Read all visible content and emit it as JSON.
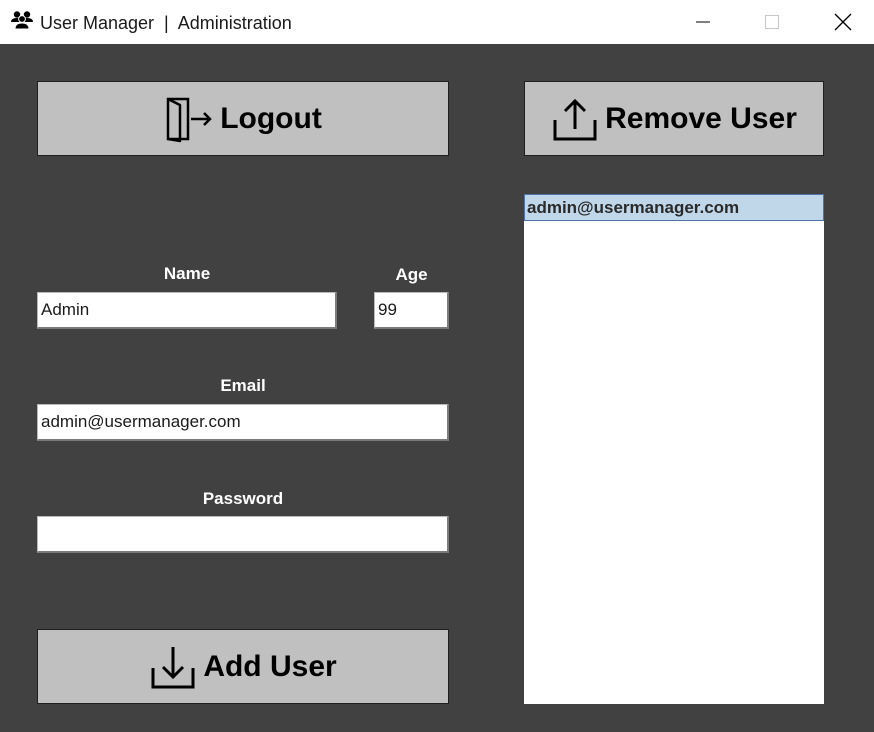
{
  "window": {
    "title": "User Manager  |  Administration",
    "app_icon": "users-icon",
    "controls": {
      "minimize_icon": "minimize-icon",
      "maximize_icon": "maximize-icon",
      "close_icon": "close-icon"
    }
  },
  "colors": {
    "background": "#414141",
    "button": "#c0c0c0",
    "selection": "#c0d7ea",
    "selection_border": "#4e74a8"
  },
  "buttons": {
    "logout": {
      "label": "Logout",
      "icon": "logout-icon"
    },
    "remove_user": {
      "label": "Remove User",
      "icon": "upload-icon"
    },
    "add_user": {
      "label": "Add User",
      "icon": "download-icon"
    }
  },
  "form": {
    "name": {
      "label": "Name",
      "value": "Admin"
    },
    "age": {
      "label": "Age",
      "value": "99"
    },
    "email": {
      "label": "Email",
      "value": "admin@usermanager.com"
    },
    "password": {
      "label": "Password",
      "value": ""
    }
  },
  "user_list": {
    "items": [
      "admin@usermanager.com"
    ],
    "selected_index": 0
  }
}
